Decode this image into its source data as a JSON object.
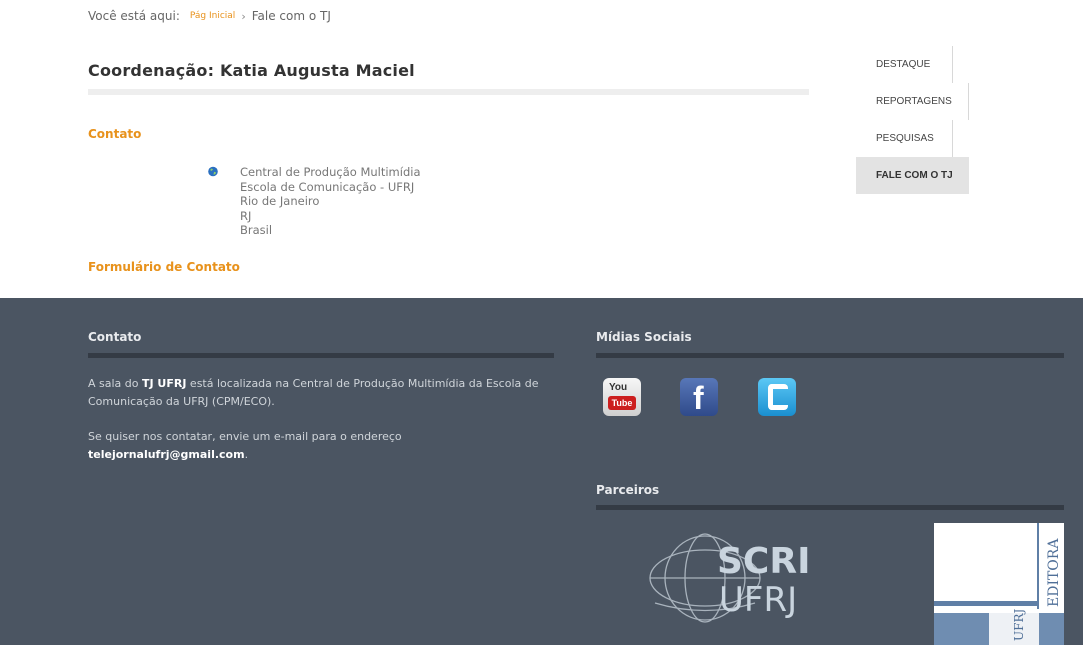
{
  "breadcrumb": {
    "prefix": "Você está aqui:",
    "home": "Pág Inicial",
    "separator": "›",
    "current": "Fale com o TJ"
  },
  "page_title": "Coordenação: Katia Augusta Maciel",
  "contact": {
    "heading": "Contato",
    "address_lines": [
      "Central de Produção Multimídia",
      "Escola de Comunicação - UFRJ",
      "Rio de Janeiro",
      "RJ",
      "Brasil"
    ],
    "form_link": "Formulário de Contato"
  },
  "side_nav": {
    "items": [
      "DESTAQUE",
      "REPORTAGENS",
      "PESQUISAS",
      "FALE COM O TJ"
    ],
    "active": "FALE COM O TJ"
  },
  "footer": {
    "contato_heading": "Contato",
    "p1_before": "A sala do ",
    "p1_bold": "TJ UFRJ",
    "p1_after": " está localizada na Central de Produção Multimídia da Escola de Comunicação da UFRJ (CPM/ECO).",
    "p2_before": "Se quiser nos contatar, envie um e-mail para o endereço ",
    "p2_email": "telejornalufrj@gmail.com",
    "p2_after": ".",
    "midias_heading": "Mídias Sociais",
    "social": {
      "youtube_you": "You",
      "youtube_tube": "Tube",
      "facebook": "f"
    },
    "parceiros_heading": "Parceiros",
    "partners": {
      "scri_top": "SCRI",
      "scri_bottom": "UFRJ",
      "editora": "EDITORA",
      "editora_ufrj": "UFRJ"
    }
  },
  "colors": {
    "accent": "#e8921c",
    "footer_bg": "#4b5562",
    "footer_rule": "#343b45"
  }
}
